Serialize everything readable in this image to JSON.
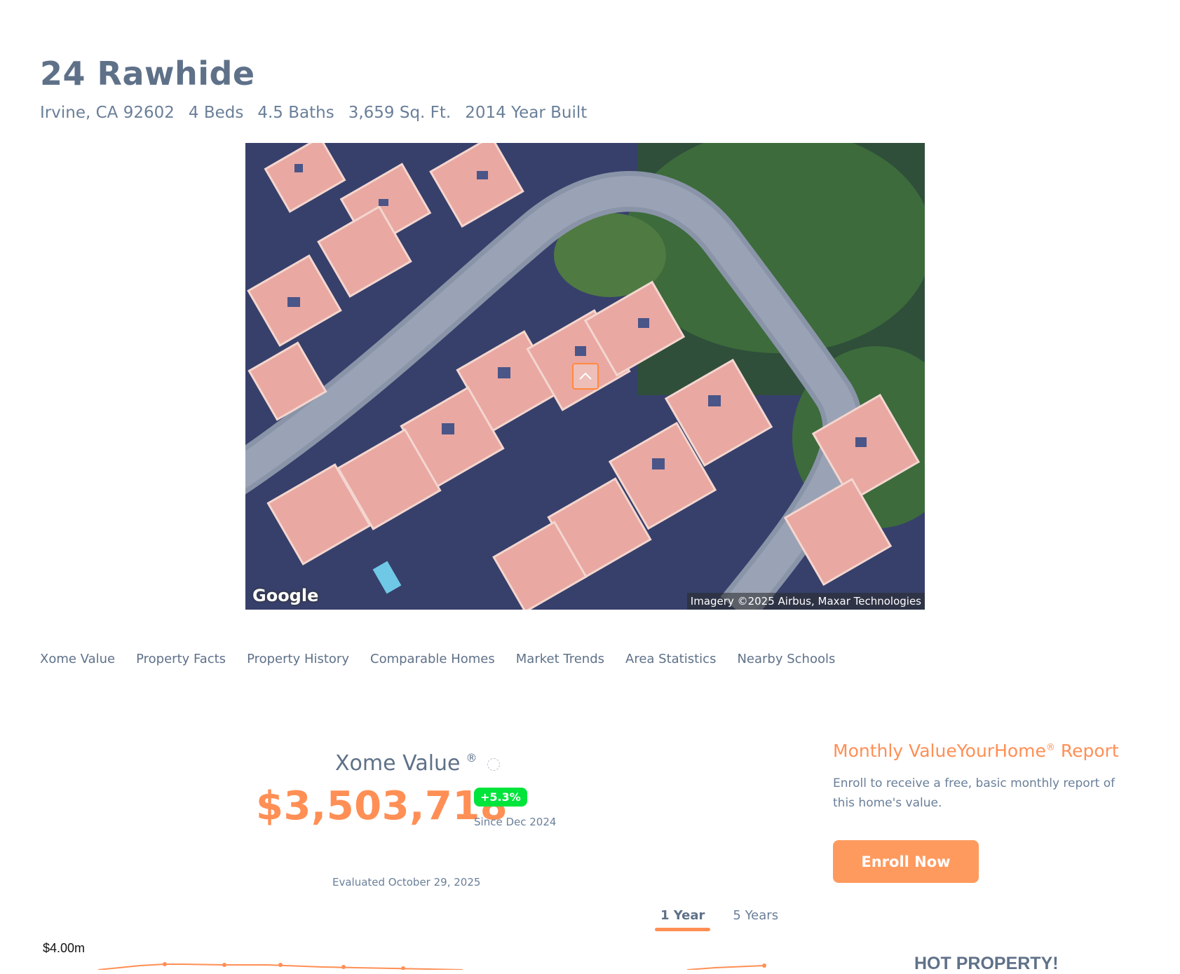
{
  "header": {
    "title": "24 Rawhide",
    "location": "Irvine, CA 92602",
    "beds": "4 Beds",
    "baths": "4.5 Baths",
    "sqft": "3,659 Sq. Ft.",
    "year_built": "2014 Year Built"
  },
  "map": {
    "google_logo": "Google",
    "credit": "Imagery ©2025 Airbus, Maxar Technologies",
    "pin_icon": "chevron-up-icon"
  },
  "nav": {
    "items": [
      "Xome Value",
      "Property Facts",
      "Property History",
      "Comparable Homes",
      "Market Trends",
      "Area Statistics",
      "Nearby Schools"
    ]
  },
  "xome_value": {
    "title": "Xome Value",
    "registered": "®",
    "value": "$3,503,718",
    "change": "+5.3%",
    "since": "Since Dec 2024",
    "evaluated": "Evaluated October 29, 2025",
    "info_icon": "info-icon"
  },
  "range_tabs": {
    "one_year": "1 Year",
    "five_years": "5 Years",
    "selected": "1 Year"
  },
  "chart_data": {
    "type": "line",
    "ytick": "$4.00m",
    "accent": "#ff8f55"
  },
  "report": {
    "title": "Monthly ValueYourHome",
    "registered": "®",
    "title_suffix": " Report",
    "description": "Enroll to receive a free, basic monthly report of this home's value.",
    "button": "Enroll Now"
  },
  "hot_property": {
    "label": "HOT PROPERTY!"
  },
  "colors": {
    "accent": "#ff8f55",
    "text": "#5f7189",
    "badge": "#00e43b"
  }
}
